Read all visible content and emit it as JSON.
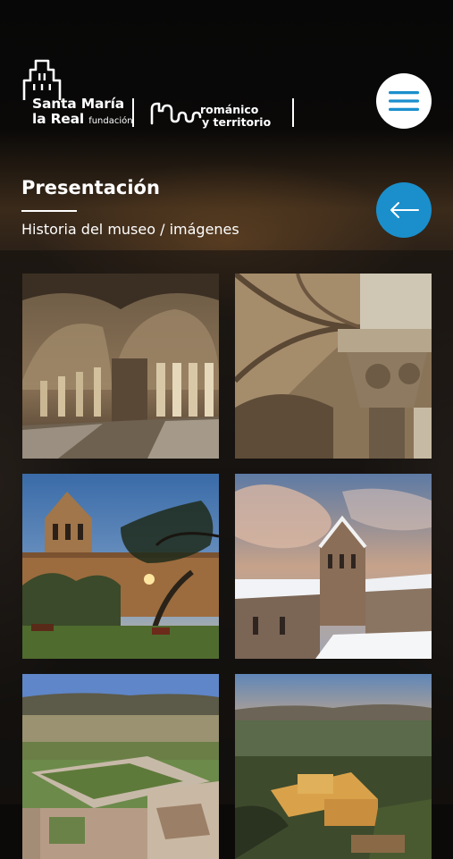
{
  "brand": {
    "name_line1": "Santa María",
    "name_line2": "la Real",
    "fundacion": "fundación",
    "rt_line1": "románico",
    "rt_line2": "y territorio"
  },
  "header": {
    "menu_icon": "hamburger-menu-icon",
    "back_icon": "arrow-left-icon",
    "accent_color": "#1a8fcc"
  },
  "page": {
    "title": "Presentación",
    "subtitle": "Historia del museo / imágenes"
  },
  "gallery": {
    "images": [
      {
        "subject": "cloister arcade"
      },
      {
        "subject": "vaulted ceiling with carved capital"
      },
      {
        "subject": "monastery bell tower at dusk with tree"
      },
      {
        "subject": "monastery in snow under cloudy sky"
      },
      {
        "subject": "aerial view of monastery complex"
      },
      {
        "subject": "aerial view of monastery at dusk"
      }
    ]
  }
}
